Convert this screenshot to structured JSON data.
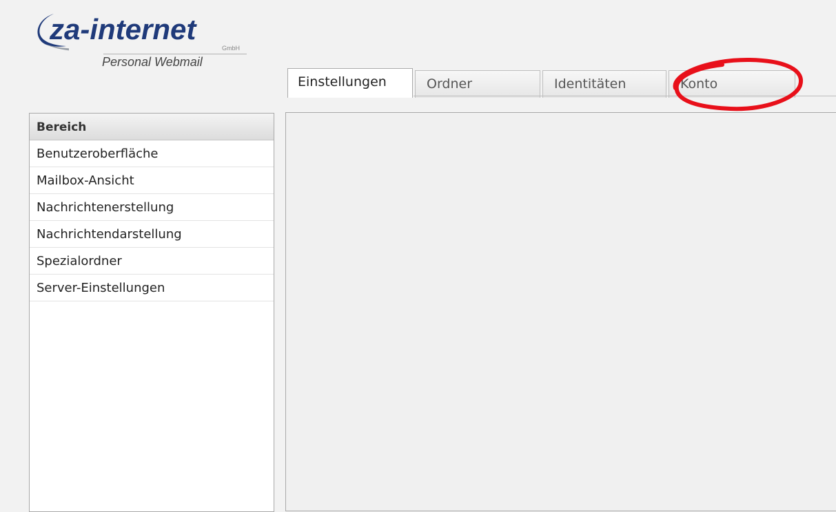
{
  "logo": {
    "name": "za-internet",
    "company_suffix": "GmbH",
    "subtitle": "Personal Webmail"
  },
  "tabs": [
    {
      "label": "Einstellungen",
      "active": true
    },
    {
      "label": "Ordner",
      "active": false
    },
    {
      "label": "Identitäten",
      "active": false
    },
    {
      "label": "Konto",
      "active": false,
      "highlighted": true
    }
  ],
  "sidebar": {
    "header": "Bereich",
    "items": [
      {
        "label": "Benutzeroberfläche"
      },
      {
        "label": "Mailbox-Ansicht"
      },
      {
        "label": "Nachrichtenerstellung"
      },
      {
        "label": "Nachrichtendarstellung"
      },
      {
        "label": "Spezialordner"
      },
      {
        "label": "Server-Einstellungen"
      }
    ]
  },
  "colors": {
    "brand_blue": "#1f3a7a",
    "highlight_red": "#e8101a",
    "background": "#f2f2f2"
  }
}
